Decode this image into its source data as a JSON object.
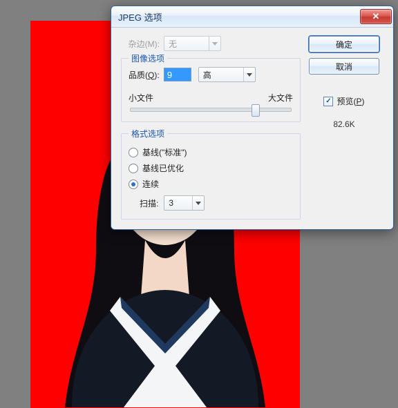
{
  "dialog": {
    "title": "JPEG 选项",
    "close_glyph": "✕",
    "matte": {
      "label": "杂边(M):",
      "value": "无"
    },
    "image_options": {
      "legend": "图像选项",
      "quality_label_pre": "品质(",
      "quality_hotkey": "Q",
      "quality_label_post": "):",
      "quality_value": "9",
      "quality_preset": "高",
      "slider": {
        "left_label": "小文件",
        "right_label": "大文件",
        "position_pct": 78
      }
    },
    "format_options": {
      "legend": "格式选项",
      "radio_baseline_standard": "基线(\"标准\")",
      "radio_baseline_optimized": "基线已优化",
      "radio_progressive": "连续",
      "selected": "progressive",
      "scans_label": "扫描:",
      "scans_value": "3"
    },
    "buttons": {
      "ok": "确定",
      "cancel": "取消"
    },
    "preview": {
      "label_pre": "预览(",
      "hotkey": "P",
      "label_post": ")",
      "checked": true,
      "check_glyph": "✓"
    },
    "filesize": "82.6K"
  }
}
